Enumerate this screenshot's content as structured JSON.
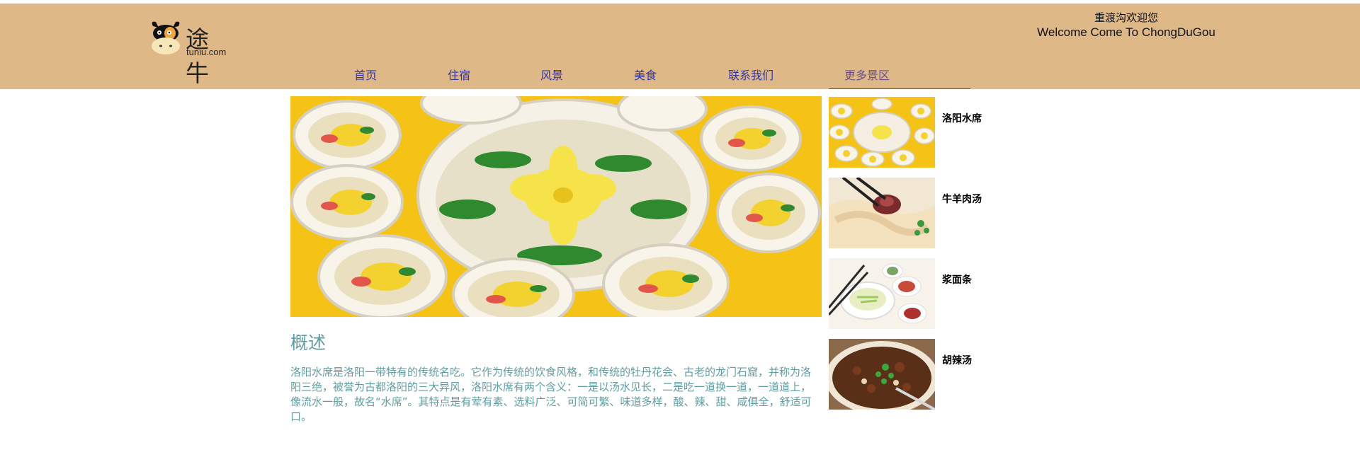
{
  "logo": {
    "brand_cn": "途牛",
    "brand_en": "tuniu.com",
    "icon": "cow-mascot-icon"
  },
  "welcome": {
    "line_cn": "重渡沟欢迎您",
    "line_en": "Welcome Come To ChongDuGou"
  },
  "nav": {
    "items": [
      {
        "label": "首页"
      },
      {
        "label": "住宿"
      },
      {
        "label": "风景"
      },
      {
        "label": "美食"
      },
      {
        "label": "联系我们"
      },
      {
        "label": "更多景区"
      }
    ]
  },
  "colors": {
    "header_bg": "#deb887",
    "nav_link": "#3333aa",
    "accent_text": "#5f9ea0"
  },
  "main": {
    "section_title": "概述",
    "section_body": "洛阳水席是洛阳一带特有的传统名吃。它作为传统的饮食风格，和传统的牡丹花会、古老的龙门石窟，并称为洛阳三绝，被誉为古都洛阳的三大异风，洛阳水席有两个含义：一是以汤水见长，二是吃一道换一道，一道道上，像流水一般，故名“水席”。其特点是有荤有素、选料广泛、可简可繁、味道多样，酸、辣、甜、咸俱全，舒适可口。"
  },
  "sidebar": {
    "items": [
      {
        "label": "洛阳水席"
      },
      {
        "label": "牛羊肉汤"
      },
      {
        "label": "浆面条"
      },
      {
        "label": "胡辣汤"
      }
    ]
  }
}
